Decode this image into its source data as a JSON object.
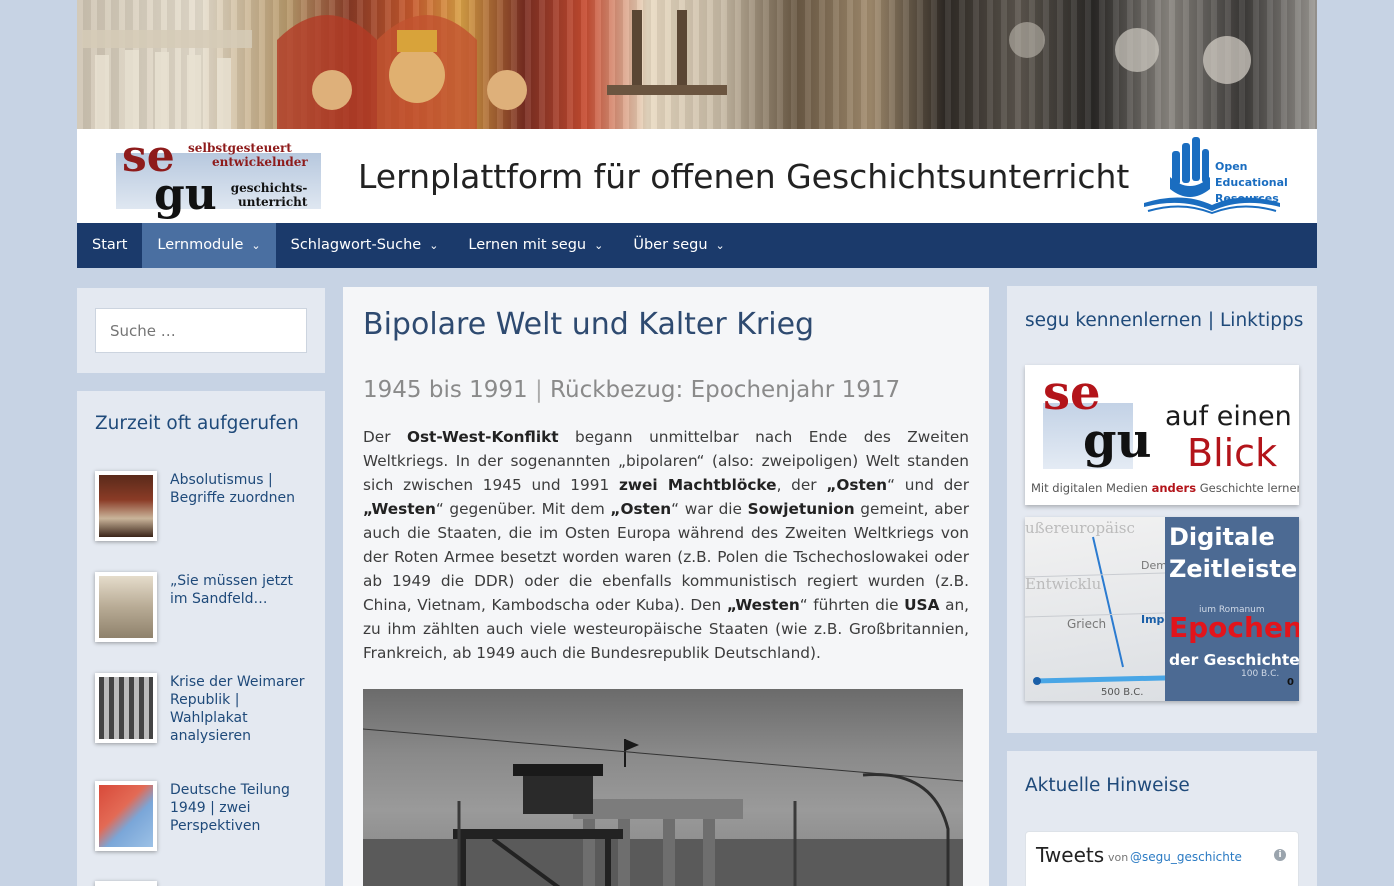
{
  "header": {
    "logo_se": "se",
    "logo_gu": "gu",
    "logo_line1": "selbstgesteuert",
    "logo_line2": "entwickelnder",
    "logo_line3": "geschichts-",
    "logo_line4": "unterricht",
    "site_title": "Lernplattform für offenen Geschichtsunterricht",
    "oer_lines": [
      "Open",
      "Educational",
      "Resources"
    ]
  },
  "nav": {
    "items": [
      {
        "label": "Start",
        "dropdown": false,
        "active": false
      },
      {
        "label": "Lernmodule",
        "dropdown": true,
        "active": true
      },
      {
        "label": "Schlagwort-Suche",
        "dropdown": true,
        "active": false
      },
      {
        "label": "Lernen mit segu",
        "dropdown": true,
        "active": false
      },
      {
        "label": "Über segu",
        "dropdown": true,
        "active": false
      }
    ],
    "chevron": "⌄"
  },
  "left_sidebar": {
    "search_placeholder": "Suche …",
    "popular_title": "Zurzeit oft aufgerufen",
    "popular_items": [
      {
        "label": "Absolutismus | Begriffe zuordnen",
        "icon": "painting-thumbnail"
      },
      {
        "label": "„Sie müssen jetzt im Sandfeld…",
        "icon": "photo-thumbnail"
      },
      {
        "label": "Krise der Weimarer Republik | Wahlplakat analysieren",
        "icon": "photo-thumbnail"
      },
      {
        "label": "Deutsche Teilung 1949 | zwei Perspektiven",
        "icon": "map-thumbnail"
      }
    ]
  },
  "main": {
    "title": "Bipolare Welt und Kalter Krieg",
    "subtitle_a": "1945 bis 1991",
    "subtitle_sep": " | ",
    "subtitle_b": "Rückbezug: Epochenjahr 1917",
    "para": {
      "t1": "Der ",
      "b1": "Ost-West-Konflikt",
      "t2": " begann unmittelbar nach Ende des Zweiten Weltkriegs. In der sogenannten „bipolaren“ (also: zweipoligen) Welt standen sich zwischen 1945 und 1991 ",
      "b2": "zwei Machtblöcke",
      "t3": ", der ",
      "b3": "„Osten",
      "t4": "“ und der ",
      "b4": "„Westen",
      "t5": "“ gegenüber. Mit dem ",
      "b5": "„Osten",
      "t6": "“ war die ",
      "b6": "Sowjetunion",
      "t7": " gemeint, aber auch die Staaten, die im Osten Europa während des Zweiten Weltkriegs von der Roten Armee besetzt worden waren (z.B. Polen die Tschechoslowakei  oder ab 1949 die DDR) oder die ebenfalls kommunistisch regiert wurden (z.B. China, Vietnam, Kambodscha oder Kuba). Den ",
      "b7": "„Westen",
      "t8": "“ führten die ",
      "b8": "USA",
      "t9": " an, zu ihm zählten auch viele westeuropäische Staaten (wie z.B. Großbritannien, Frankreich, ab 1949 auch die Bundesrepublik Deutschland)."
    }
  },
  "right_sidebar": {
    "links_title": "segu kennenlernen | Linktipps",
    "promo1": {
      "se": "se",
      "gu": "gu",
      "line1": "auf einen",
      "line2": "Blick",
      "footer_a": "Mit digitalen Medien ",
      "footer_b": "anders",
      "footer_c": " Geschichte lernen"
    },
    "promo2": {
      "line1": "Digitale",
      "line2": "Zeitleiste",
      "line3": "Epochen",
      "line4": "der Geschichte",
      "bg_words": [
        "ußereuropäisc",
        "Entwicklu",
        "Griech",
        "Impe",
        "ium Romanum",
        "Dem",
        "500 B.C.",
        "100 B.C.",
        "0"
      ]
    },
    "hints_title": "Aktuelle Hinweise",
    "tweets": {
      "label": "Tweets",
      "by": "von",
      "handle": "@segu_geschichte",
      "info_icon": "i"
    }
  },
  "colors": {
    "page_bg": "#c7d3e4",
    "nav_bg": "#1b3a6b",
    "nav_active": "#4a6fa1",
    "link": "#1f4a7a",
    "brand_red": "#8e1b1b"
  }
}
